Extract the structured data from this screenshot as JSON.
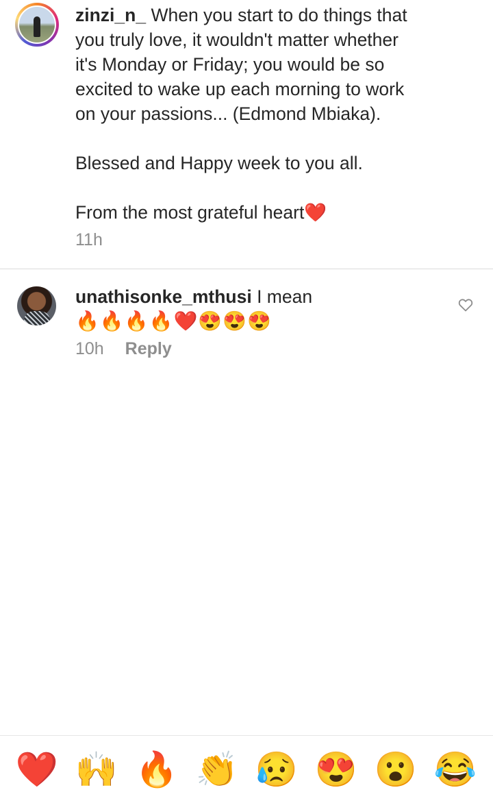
{
  "caption": {
    "username": "zinzi_n_",
    "line1_after_user": "When you start to do things that",
    "line2": "you truly love, it wouldn't matter whether",
    "line3": "it's Monday or Friday; you would be so",
    "line4": "excited to wake up each morning to work",
    "line5": "on your passions... (Edmond Mbiaka).",
    "para2": "Blessed and Happy week to you all.",
    "para3": "From the most grateful heart❤️",
    "time": "11h"
  },
  "comment": {
    "username": "unathisonke_mthusi",
    "text": "I mean",
    "emoji_text": "🔥🔥🔥🔥❤️😍😍😍",
    "time": "10h",
    "reply_label": "Reply"
  },
  "reactions": [
    {
      "emoji": "❤️",
      "name": "heart"
    },
    {
      "emoji": "🙌",
      "name": "raising-hands"
    },
    {
      "emoji": "🔥",
      "name": "fire"
    },
    {
      "emoji": "👏",
      "name": "clapping-hands"
    },
    {
      "emoji": "😥",
      "name": "sad-relieved-face"
    },
    {
      "emoji": "😍",
      "name": "heart-eyes"
    },
    {
      "emoji": "😮",
      "name": "surprised-face"
    },
    {
      "emoji": "😂",
      "name": "tears-of-joy"
    }
  ],
  "colors": {
    "text": "#262626",
    "muted": "#8e8e8e",
    "divider": "#dbdbdb"
  }
}
